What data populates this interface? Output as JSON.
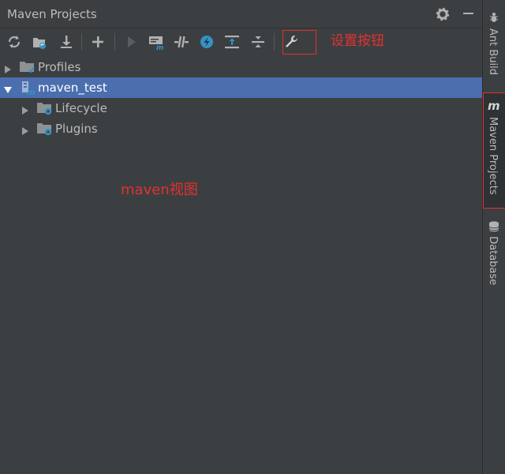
{
  "panel": {
    "title": "Maven Projects",
    "title_icons": [
      "gear-icon",
      "minimize-icon"
    ]
  },
  "toolbar": {
    "buttons": [
      {
        "name": "reimport-icon",
        "tooltip": "Reimport"
      },
      {
        "name": "generate-sources-icon",
        "tooltip": "Generate Sources"
      },
      {
        "name": "download-icon",
        "tooltip": "Download"
      },
      {
        "name": "add-icon",
        "tooltip": "Add Maven Projects"
      },
      {
        "name": "run-icon",
        "tooltip": "Run"
      },
      {
        "name": "execute-goal-icon",
        "tooltip": "Execute Maven Goal"
      },
      {
        "name": "toggle-offline-icon",
        "tooltip": "Toggle Offline"
      },
      {
        "name": "skip-tests-icon",
        "tooltip": "Skip Tests"
      },
      {
        "name": "show-dependencies-icon",
        "tooltip": "Show Dependencies"
      },
      {
        "name": "collapse-all-icon",
        "tooltip": "Collapse All"
      },
      {
        "name": "settings-wrench-icon",
        "tooltip": "Maven Settings"
      }
    ]
  },
  "annotations": {
    "settings_button": "设置按钮",
    "maven_view": "maven视图"
  },
  "tree": {
    "items": [
      {
        "label": "Profiles",
        "expanded": false,
        "selected": false
      },
      {
        "label": "maven_test",
        "expanded": true,
        "selected": true
      },
      {
        "label": "Lifecycle",
        "expanded": false,
        "selected": false
      },
      {
        "label": "Plugins",
        "expanded": false,
        "selected": false
      }
    ]
  },
  "sidebar": {
    "tabs": [
      {
        "label": "Ant Build",
        "icon": "ant-icon",
        "active": false
      },
      {
        "label": "Maven Projects",
        "icon": "maven-m-icon",
        "active": true
      },
      {
        "label": "Database",
        "icon": "database-icon",
        "active": false
      }
    ]
  },
  "colors": {
    "background": "#3c3f41",
    "selection": "#4b6eaf",
    "annotation": "#e53030",
    "text": "#bbbbbb"
  }
}
